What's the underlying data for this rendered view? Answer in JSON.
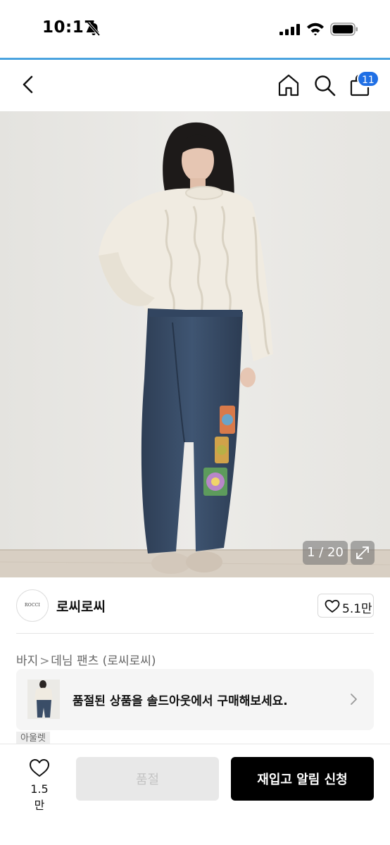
{
  "status_bar": {
    "time": "10:17",
    "icons": [
      "bell-off-icon",
      "cellular-signal-icon",
      "wifi-icon",
      "battery-icon"
    ]
  },
  "nav": {
    "icons": [
      "back-icon",
      "home-icon",
      "search-icon",
      "shopping-bag-icon"
    ],
    "cart_badge": "11",
    "accent_color": "#1f6fe5"
  },
  "gallery": {
    "counter": "1 / 20",
    "expand_icon": "expand-icon"
  },
  "brand": {
    "logo_text": "ROCCI ROCCI",
    "name": "로씨로씨",
    "like_count": "5.1만"
  },
  "breadcrumb": {
    "category": "바지",
    "separator": ">",
    "subcategory": "데님 팬츠 (로씨로씨)"
  },
  "soldout_banner": {
    "text": "품절된 상품을 솔드아웃에서 구매해보세요."
  },
  "outlet_tag": "아울렛",
  "bottom_bar": {
    "like_count": "1.5만",
    "soldout_label": "품절",
    "restock_label": "재입고 알림 신청"
  }
}
